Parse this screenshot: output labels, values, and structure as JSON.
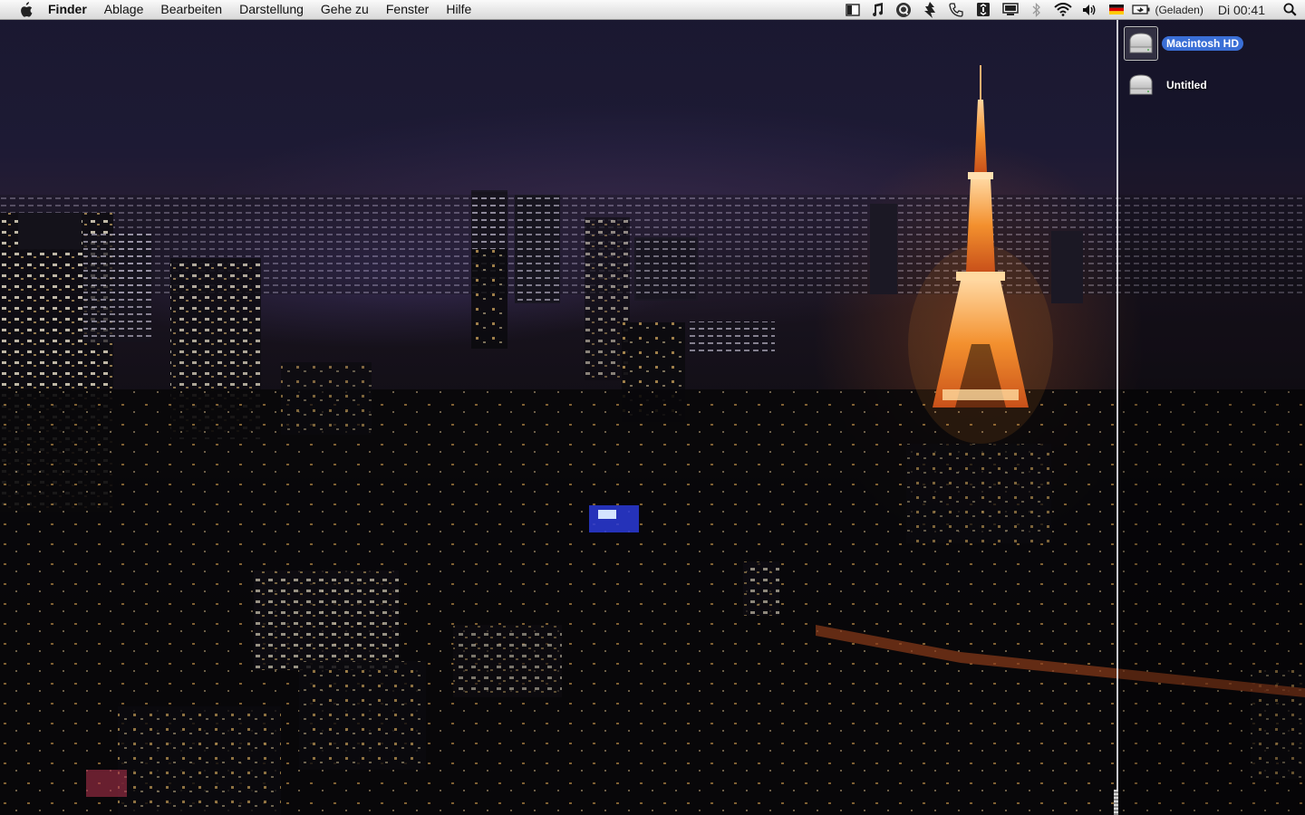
{
  "menubar": {
    "apple_icon": "apple-logo-icon",
    "app_name": "Finder",
    "menus": [
      "Ablage",
      "Bearbeiten",
      "Darstellung",
      "Gehe zu",
      "Fenster",
      "Hilfe"
    ],
    "status_items": [
      {
        "name": "sidebar-toggle-icon"
      },
      {
        "name": "music-note-icon"
      },
      {
        "name": "quicksilver-icon"
      },
      {
        "name": "growl-icon"
      },
      {
        "name": "phone-icon"
      },
      {
        "name": "timemachine-icon"
      },
      {
        "name": "display-icon"
      },
      {
        "name": "bluetooth-icon"
      },
      {
        "name": "wifi-icon"
      },
      {
        "name": "volume-icon"
      },
      {
        "name": "german-flag-icon"
      }
    ],
    "battery_status": "(Geladen)",
    "clock": "Di 00:41",
    "spotlight_icon": "spotlight-search-icon"
  },
  "desktop": {
    "drives": [
      {
        "label": "Macintosh HD",
        "icon": "hard-drive-icon",
        "selected": true
      },
      {
        "label": "Untitled",
        "icon": "hard-drive-icon",
        "selected": false
      }
    ]
  },
  "colors": {
    "selection": "#3a6fd6",
    "menubar_top": "#fafafa",
    "menubar_bottom": "#d9d9d9",
    "tower_glow": "#f08a2a"
  }
}
